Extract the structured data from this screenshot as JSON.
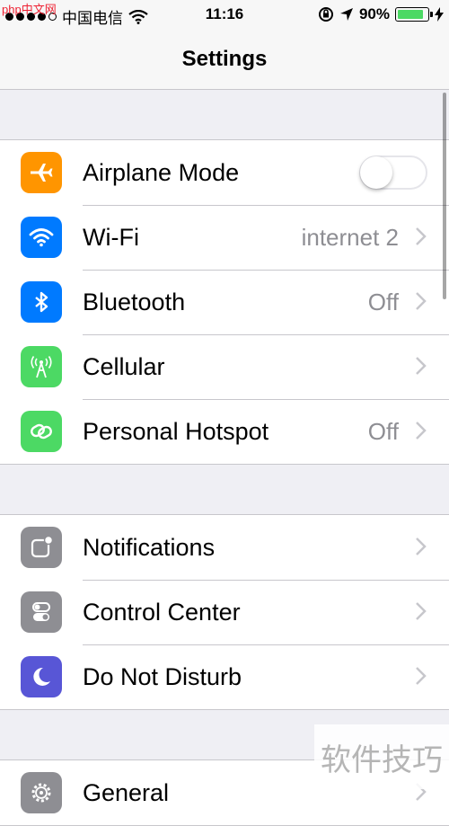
{
  "status_bar": {
    "watermark": "php中文网",
    "carrier": "中国电信",
    "time": "11:16",
    "battery_percent": "90%",
    "battery_level": 0.9,
    "icons": [
      "signal-dots-icon",
      "wifi-icon",
      "rotation-lock-icon",
      "location-arrow-icon",
      "battery-icon",
      "charging-bolt-icon"
    ]
  },
  "nav": {
    "title": "Settings"
  },
  "groups": [
    {
      "rows": [
        {
          "label": "Airplane Mode",
          "icon": "airplane-icon",
          "icon_color": "#ff9500",
          "accessory": "toggle",
          "toggle_on": false
        },
        {
          "label": "Wi-Fi",
          "icon": "wifi-icon",
          "icon_color": "#007aff",
          "value": "internet 2",
          "accessory": "chevron"
        },
        {
          "label": "Bluetooth",
          "icon": "bluetooth-icon",
          "icon_color": "#007aff",
          "value": "Off",
          "accessory": "chevron"
        },
        {
          "label": "Cellular",
          "icon": "cellular-antenna-icon",
          "icon_color": "#4cd964",
          "accessory": "chevron"
        },
        {
          "label": "Personal Hotspot",
          "icon": "hotspot-icon",
          "icon_color": "#4cd964",
          "value": "Off",
          "accessory": "chevron"
        }
      ]
    },
    {
      "rows": [
        {
          "label": "Notifications",
          "icon": "notifications-icon",
          "icon_color": "#8e8e93",
          "accessory": "chevron"
        },
        {
          "label": "Control Center",
          "icon": "control-center-icon",
          "icon_color": "#8e8e93",
          "accessory": "chevron"
        },
        {
          "label": "Do Not Disturb",
          "icon": "moon-icon",
          "icon_color": "#5856d6",
          "accessory": "chevron"
        }
      ]
    },
    {
      "rows": [
        {
          "label": "General",
          "icon": "gear-icon",
          "icon_color": "#8e8e93",
          "accessory": "chevron"
        }
      ]
    }
  ],
  "watermark": "软件技巧"
}
